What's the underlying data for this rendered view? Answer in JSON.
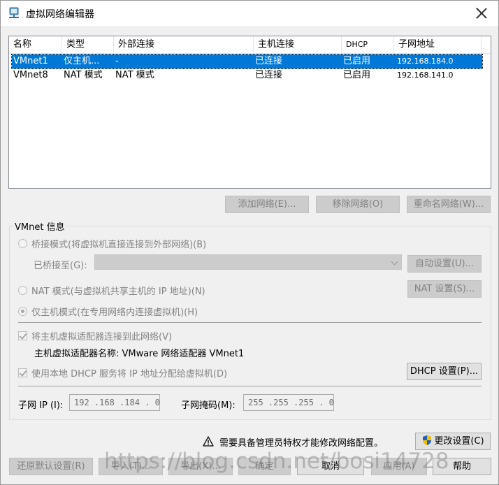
{
  "window": {
    "title": "虚拟网络编辑器"
  },
  "table": {
    "headers": [
      "名称",
      "类型",
      "外部连接",
      "主机连接",
      "DHCP",
      "子网地址"
    ],
    "rows": [
      {
        "name": "VMnet1",
        "type": "仅主机...",
        "external": "-",
        "host": "已连接",
        "dhcp": "已启用",
        "subnet": "192.168.184.0"
      },
      {
        "name": "VMnet8",
        "type": "NAT 模式",
        "external": "NAT 模式",
        "host": "已连接",
        "dhcp": "已启用",
        "subnet": "192.168.141.0"
      }
    ]
  },
  "network_buttons": {
    "add": "添加网络(E)...",
    "remove": "移除网络(O)",
    "rename": "重命名网络(W)..."
  },
  "vmnet_info": {
    "group_label": "VMnet 信息",
    "bridged_label": "桥接模式(将虚拟机直接连接到外部网络)(B)",
    "bridged_to_label": "已桥接至(G):",
    "bridged_to_value": "",
    "auto_settings": "自动设置(U)...",
    "nat_label": "NAT 模式(与虚拟机共享主机的 IP 地址)(N)",
    "nat_settings": "NAT 设置(S)...",
    "hostonly_label": "仅主机模式(在专用网络内连接虚拟机)(H)",
    "connect_adapter_label": "将主机虚拟适配器连接到此网络(V)",
    "adapter_name_label": "主机虚拟适配器名称: VMware 网络适配器 VMnet1",
    "dhcp_label": "使用本地 DHCP 服务将 IP 地址分配给虚拟机(D)",
    "dhcp_settings": "DHCP 设置(P)...",
    "subnet_ip_label": "子网 IP (I):",
    "subnet_ip_value": "192 .168 .184 . 0",
    "subnet_mask_label": "子网掩码(M):",
    "subnet_mask_value": "255 .255 .255 . 0"
  },
  "admin": {
    "warning_text": "需要具备管理员特权才能修改网络配置。",
    "change_settings": "更改设置(C)"
  },
  "footer": {
    "restore_defaults": "还原默认设置(R)",
    "import": "导入(T)...",
    "export": "导出(X)...",
    "ok": "确定",
    "cancel": "取消",
    "apply": "应用(A)",
    "help": "帮助"
  },
  "colors": {
    "selection": "#0078d7",
    "disabled_text": "#838383",
    "shield_blue": "#1f5fbf",
    "shield_yellow": "#f2c200"
  },
  "watermark": "https://blog.csdn.net/bosi14728"
}
